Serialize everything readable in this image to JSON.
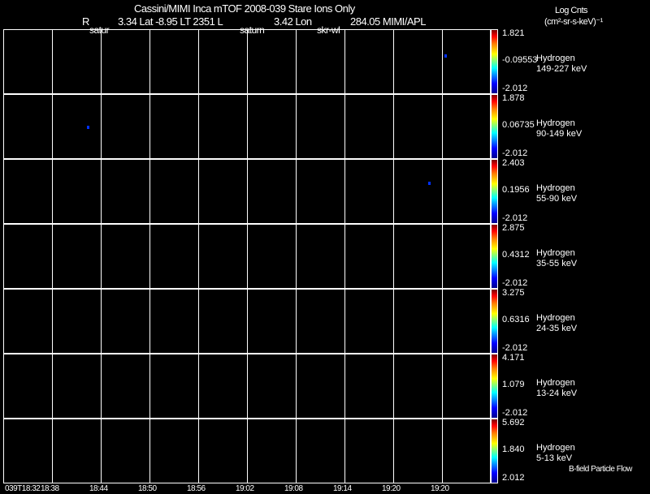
{
  "header": {
    "title": "Cassini/MIMI Inca mTOF  2008-039   Stare   Ions Only",
    "r_label": "R",
    "r_value": "3.34 Lat -8.95 LT 2351 L",
    "l_value": "3.42 Lon",
    "lon_value": "284.05  MIMI/APL",
    "overlay_labels": [
      "satur",
      "saturn",
      "skr-wl"
    ]
  },
  "colorbar_title": [
    "Log Cnts",
    "(cm²-sr-s-keV)⁻¹"
  ],
  "footer_note": "B-field Particle Flow",
  "chart_data": {
    "type": "heatmap",
    "x_ticks": [
      "039T18:32",
      "18:38",
      "18:44",
      "18:50",
      "18:56",
      "19:02",
      "19:08",
      "19:14",
      "19:20",
      "19:20"
    ],
    "grid": true,
    "panels": [
      {
        "species": "Hydrogen",
        "energy": "149-227 keV",
        "cmax": "1.821",
        "cmid": "-0.09553",
        "cmin": "-2.012",
        "points": [
          {
            "x": "19:22",
            "color": "#0030ff"
          }
        ]
      },
      {
        "species": "Hydrogen",
        "energy": "90-149 keV",
        "cmax": "1.878",
        "cmid": "0.06735",
        "cmin": "-2.012",
        "points": [
          {
            "x": "18:38",
            "color": "#0030ff"
          }
        ]
      },
      {
        "species": "Hydrogen",
        "energy": "55-90 keV",
        "cmax": "2.403",
        "cmid": "0.1956",
        "cmin": "-2.012",
        "points": [
          {
            "x": "19:20",
            "color": "#0030ff"
          }
        ]
      },
      {
        "species": "Hydrogen",
        "energy": "35-55 keV",
        "cmax": "2.875",
        "cmid": "0.4312",
        "cmin": "-2.012",
        "points": []
      },
      {
        "species": "Hydrogen",
        "energy": "24-35 keV",
        "cmax": "3.275",
        "cmid": "0.6316",
        "cmin": "-2.012",
        "points": []
      },
      {
        "species": "Hydrogen",
        "energy": "13-24 keV",
        "cmax": "4.171",
        "cmid": "1.079",
        "cmin": "-2.012",
        "points": []
      },
      {
        "species": "Hydrogen",
        "energy": "5-13 keV",
        "cmax": "5.692",
        "cmid": "1.840",
        "cmin": "2.012",
        "points": []
      }
    ]
  }
}
